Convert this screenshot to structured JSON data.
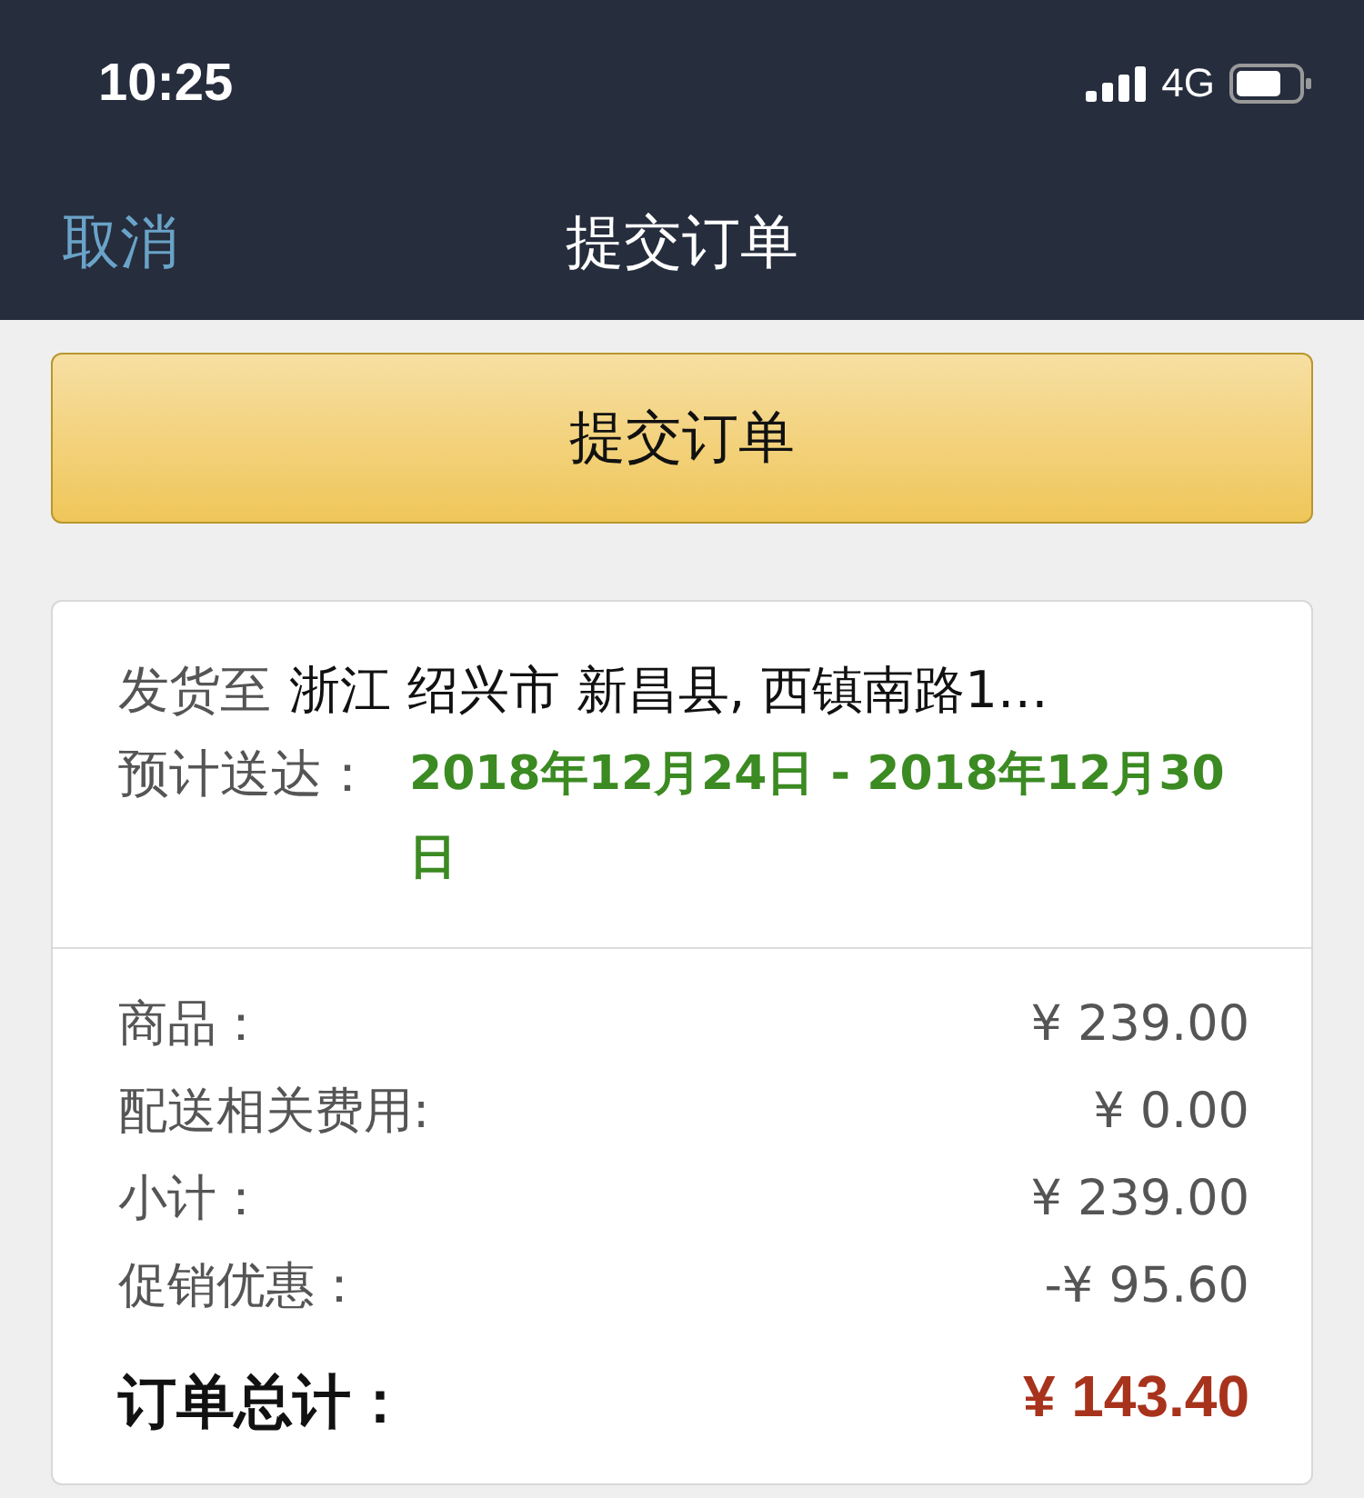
{
  "status_bar": {
    "time": "10:25",
    "network": "4G"
  },
  "nav": {
    "cancel": "取消",
    "title": "提交订单"
  },
  "submit_button": "提交订单",
  "shipping": {
    "label": "发货至",
    "address": "浙江 绍兴市 新昌县, 西镇南路1…",
    "eta_label": "预计送达：",
    "eta": "2018年12月24日 - 2018年12月30日"
  },
  "summary": [
    {
      "label": "商品：",
      "value": "¥ 239.00"
    },
    {
      "label": "配送相关费用:",
      "value": "¥ 0.00"
    },
    {
      "label": "小计：",
      "value": "¥ 239.00"
    },
    {
      "label": "促销优惠：",
      "value": "-¥ 95.60"
    }
  ],
  "total": {
    "label": "订单总计：",
    "value": "¥ 143.40"
  }
}
